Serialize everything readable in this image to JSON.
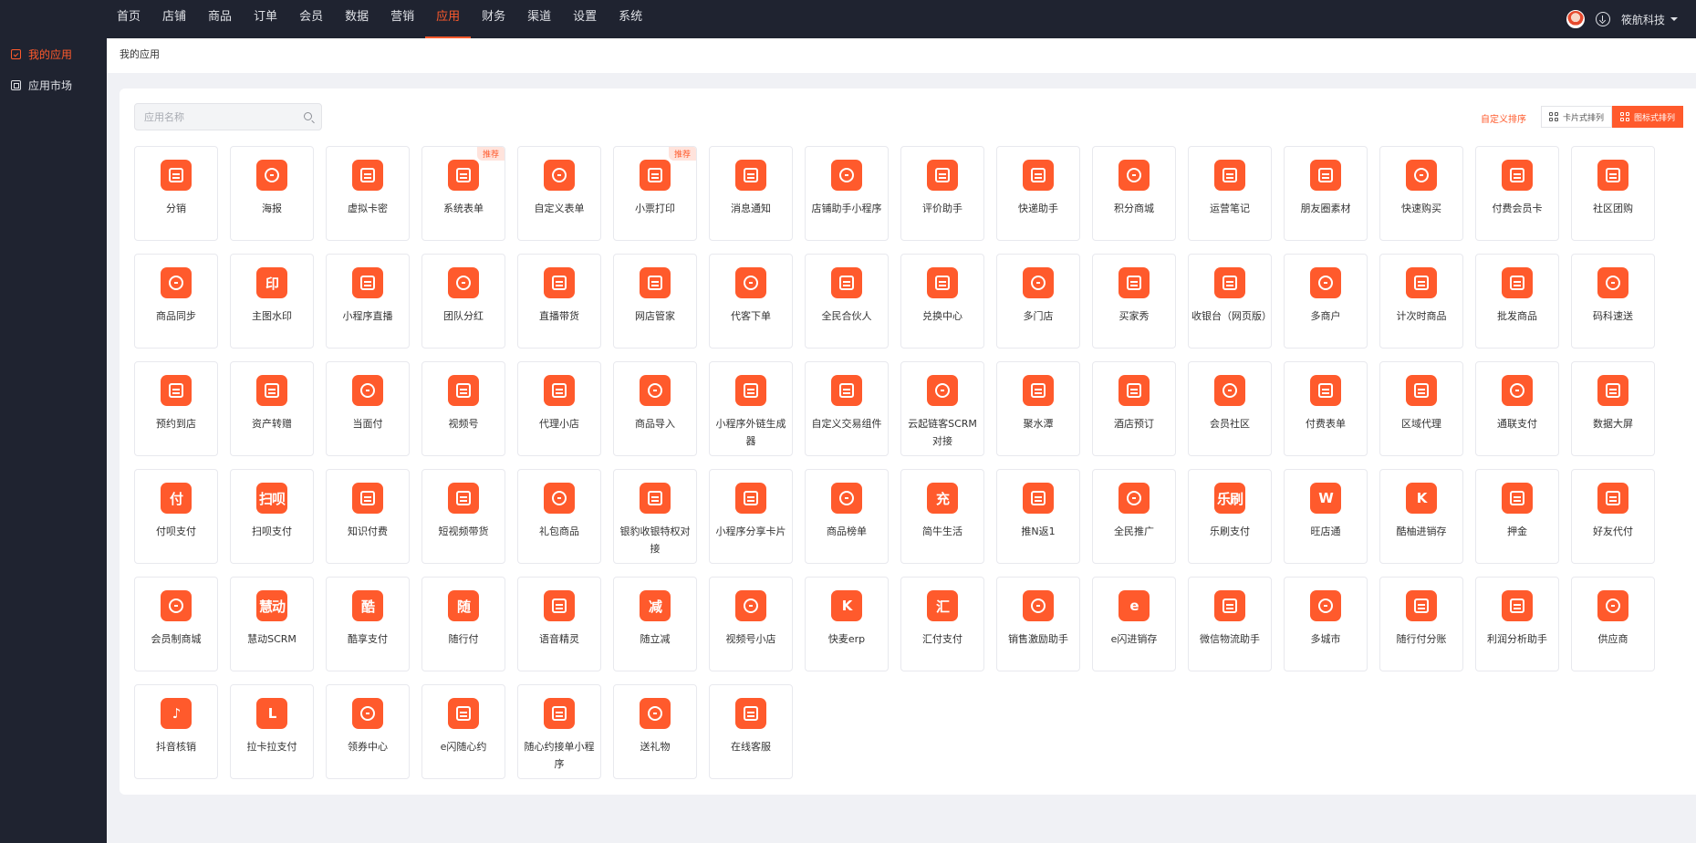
{
  "accent_color": "#ff5a2c",
  "topnav": {
    "items": [
      "首页",
      "店铺",
      "商品",
      "订单",
      "会员",
      "数据",
      "营销",
      "应用",
      "财务",
      "渠道",
      "设置",
      "系统"
    ],
    "active_index": 7,
    "company": "筱航科技"
  },
  "sidebar": {
    "items": [
      {
        "label": "我的应用",
        "active": true,
        "icon": "my-apps-icon"
      },
      {
        "label": "应用市场",
        "active": false,
        "icon": "app-market-icon"
      }
    ]
  },
  "breadcrumb": "我的应用",
  "search": {
    "placeholder": "应用名称",
    "value": ""
  },
  "toolbar": {
    "custom_sort": "自定义排序",
    "card_view": "卡片式排列",
    "icon_view": "图标式排列",
    "active_view": "icon"
  },
  "apps": [
    {
      "name": "分销",
      "icon": "sitemap-icon"
    },
    {
      "name": "海报",
      "icon": "poster-icon"
    },
    {
      "name": "虚拟卡密",
      "icon": "card-icon"
    },
    {
      "name": "系统表单",
      "icon": "form-icon",
      "badge": "推荐"
    },
    {
      "name": "自定义表单",
      "icon": "custom-form-icon"
    },
    {
      "name": "小票打印",
      "icon": "printer-icon",
      "badge": "推荐"
    },
    {
      "name": "消息通知",
      "icon": "message-icon"
    },
    {
      "name": "店铺助手小程序",
      "icon": "phone-icon"
    },
    {
      "name": "评价助手",
      "icon": "chat-icon"
    },
    {
      "name": "快递助手",
      "icon": "truck-icon"
    },
    {
      "name": "积分商城",
      "icon": "bag-icon"
    },
    {
      "name": "运营笔记",
      "icon": "pencil-icon"
    },
    {
      "name": "朋友圈素材",
      "icon": "aperture-icon"
    },
    {
      "name": "快速购买",
      "icon": "cart-icon"
    },
    {
      "name": "付费会员卡",
      "icon": "vip-card-icon"
    },
    {
      "name": "社区团购",
      "icon": "community-icon"
    },
    {
      "name": "商品同步",
      "icon": "sync-bag-icon"
    },
    {
      "name": "主图水印",
      "icon": "watermark-icon",
      "glyph": "印"
    },
    {
      "name": "小程序直播",
      "icon": "camera-icon"
    },
    {
      "name": "团队分红",
      "icon": "dividend-icon"
    },
    {
      "name": "直播带货",
      "icon": "tv-icon"
    },
    {
      "name": "网店管家",
      "icon": "manager-icon"
    },
    {
      "name": "代客下单",
      "icon": "ticket-icon"
    },
    {
      "name": "全民合伙人",
      "icon": "partner-icon"
    },
    {
      "name": "兑换中心",
      "icon": "exchange-icon"
    },
    {
      "name": "多门店",
      "icon": "store-icon"
    },
    {
      "name": "买家秀",
      "icon": "image-icon"
    },
    {
      "name": "收银台（网页版）",
      "icon": "cashier-icon"
    },
    {
      "name": "多商户",
      "icon": "shop-icon"
    },
    {
      "name": "计次时商品",
      "icon": "hourglass-icon"
    },
    {
      "name": "批发商品",
      "icon": "wholesale-icon"
    },
    {
      "name": "码科速送",
      "icon": "rocket-icon"
    },
    {
      "name": "预约到店",
      "icon": "calendar-icon"
    },
    {
      "name": "资产转赠",
      "icon": "transfer-icon"
    },
    {
      "name": "当面付",
      "icon": "scan-pay-icon"
    },
    {
      "name": "视频号",
      "icon": "video-channel-icon"
    },
    {
      "name": "代理小店",
      "icon": "agent-store-icon"
    },
    {
      "name": "商品导入",
      "icon": "import-icon"
    },
    {
      "name": "小程序外链生成器",
      "icon": "link-icon"
    },
    {
      "name": "自定义交易组件",
      "icon": "component-icon"
    },
    {
      "name": "云起链客SCRM对接",
      "icon": "chain-icon"
    },
    {
      "name": "聚水潭",
      "icon": "drop-icon"
    },
    {
      "name": "酒店预订",
      "icon": "hotel-icon"
    },
    {
      "name": "会员社区",
      "icon": "edit-icon"
    },
    {
      "name": "付费表单",
      "icon": "paid-form-icon"
    },
    {
      "name": "区域代理",
      "icon": "location-icon"
    },
    {
      "name": "通联支付",
      "icon": "pinwheel-icon"
    },
    {
      "name": "数据大屏",
      "icon": "dashboard-icon"
    },
    {
      "name": "付呗支付",
      "icon": "fubei-icon",
      "glyph": "付"
    },
    {
      "name": "扫呗支付",
      "icon": "saobei-icon",
      "glyph": "扫呗"
    },
    {
      "name": "知识付费",
      "icon": "book-icon"
    },
    {
      "name": "短视频带货",
      "icon": "play-icon"
    },
    {
      "name": "礼包商品",
      "icon": "gift-icon"
    },
    {
      "name": "银豹收银特权对接",
      "icon": "leopard-icon"
    },
    {
      "name": "小程序分享卡片",
      "icon": "share-icon"
    },
    {
      "name": "商品榜单",
      "icon": "trophy-icon"
    },
    {
      "name": "简牛生活",
      "icon": "jianniu-icon",
      "glyph": "充"
    },
    {
      "name": "推N返1",
      "icon": "rebate-icon"
    },
    {
      "name": "全民推广",
      "icon": "promote-icon"
    },
    {
      "name": "乐刷支付",
      "icon": "leshua-icon",
      "glyph": "乐刷"
    },
    {
      "name": "旺店通",
      "icon": "wangdian-icon",
      "glyph": "W"
    },
    {
      "name": "酷柚进销存",
      "icon": "kuyou-icon",
      "glyph": "K"
    },
    {
      "name": "押金",
      "icon": "coins-icon"
    },
    {
      "name": "好友代付",
      "icon": "friend-pay-icon"
    },
    {
      "name": "会员制商城",
      "icon": "crown-icon"
    },
    {
      "name": "慧动SCRM",
      "icon": "huidong-icon",
      "glyph": "慧动"
    },
    {
      "name": "酷享支付",
      "icon": "kuxiang-icon",
      "glyph": "酷"
    },
    {
      "name": "随行付",
      "icon": "suixing-icon",
      "glyph": "随"
    },
    {
      "name": "语音精灵",
      "icon": "microphone-icon"
    },
    {
      "name": "随立减",
      "icon": "discount-icon",
      "glyph": "减"
    },
    {
      "name": "视频号小店",
      "icon": "video-store-icon"
    },
    {
      "name": "快麦erp",
      "icon": "kuaimai-icon",
      "glyph": "K"
    },
    {
      "name": "汇付支付",
      "icon": "huifu-icon",
      "glyph": "汇"
    },
    {
      "name": "销售激励助手",
      "icon": "incentive-icon"
    },
    {
      "name": "e闪进销存",
      "icon": "eshan-icon",
      "glyph": "e"
    },
    {
      "name": "微信物流助手",
      "icon": "logistics-icon"
    },
    {
      "name": "多城市",
      "icon": "city-icon"
    },
    {
      "name": "随行付分账",
      "icon": "split-icon"
    },
    {
      "name": "利润分析助手",
      "icon": "analysis-icon"
    },
    {
      "name": "供应商",
      "icon": "supplier-icon"
    },
    {
      "name": "抖音核销",
      "icon": "tiktok-icon",
      "glyph": "♪"
    },
    {
      "name": "拉卡拉支付",
      "icon": "lakala-icon",
      "glyph": "L"
    },
    {
      "name": "领券中心",
      "icon": "coupon-icon"
    },
    {
      "name": "e闪随心约",
      "icon": "appointment-icon"
    },
    {
      "name": "随心约接单小程序",
      "icon": "order-taking-icon"
    },
    {
      "name": "送礼物",
      "icon": "present-icon"
    },
    {
      "name": "在线客服",
      "icon": "service-icon"
    }
  ]
}
